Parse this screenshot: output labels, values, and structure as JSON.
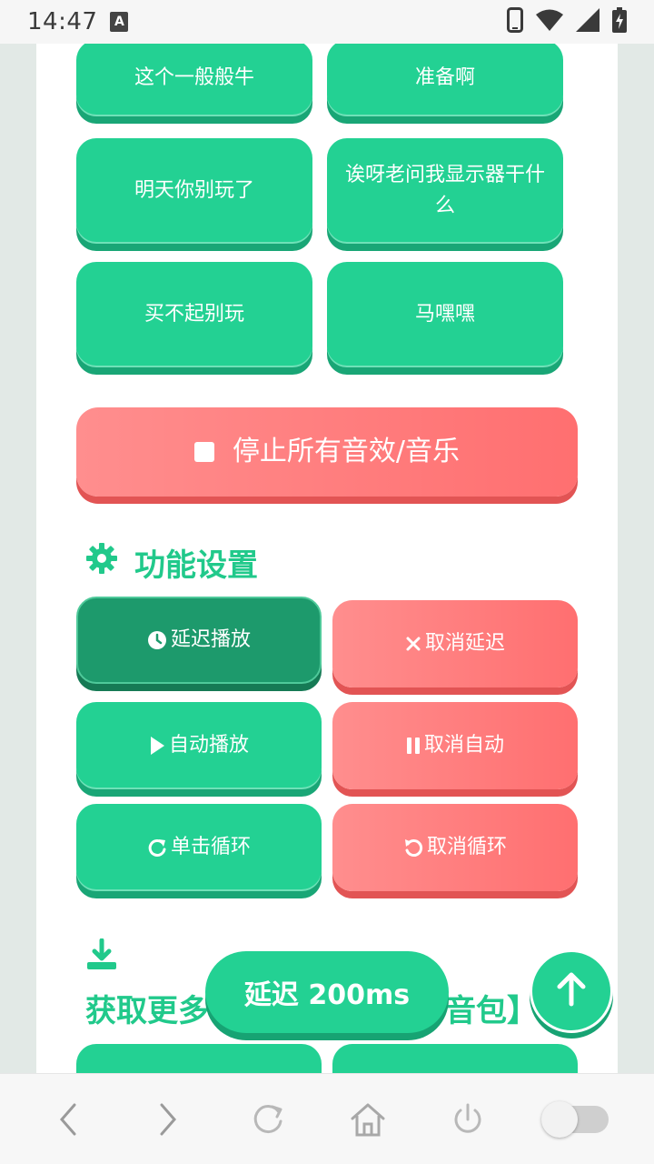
{
  "status_bar": {
    "time": "14:47",
    "badge": "A"
  },
  "sound_buttons": [
    {
      "label": "这个一般般牛"
    },
    {
      "label": "准备啊"
    },
    {
      "label": "明天你别玩了"
    },
    {
      "label": "诶呀老问我显示器干什么"
    },
    {
      "label": "买不起别玩"
    },
    {
      "label": "马嘿嘿"
    }
  ],
  "stop_button": {
    "label": "停止所有音效/音乐"
  },
  "settings": {
    "title": "功能设置",
    "buttons": {
      "delay_play": "延迟播放",
      "cancel_delay": "取消延迟",
      "auto_play": "自动播放",
      "cancel_auto": "取消自动",
      "click_loop": "单击循环",
      "cancel_loop": "取消循环"
    }
  },
  "more": {
    "title_left": "获取更多",
    "title_right": "音包】"
  },
  "delay_pill": {
    "label": "延迟 200ms"
  },
  "colors": {
    "green": "#23d193",
    "green_dark": "#1d9a6c",
    "red": "#ff7a7b",
    "title_green": "#21c98b"
  }
}
